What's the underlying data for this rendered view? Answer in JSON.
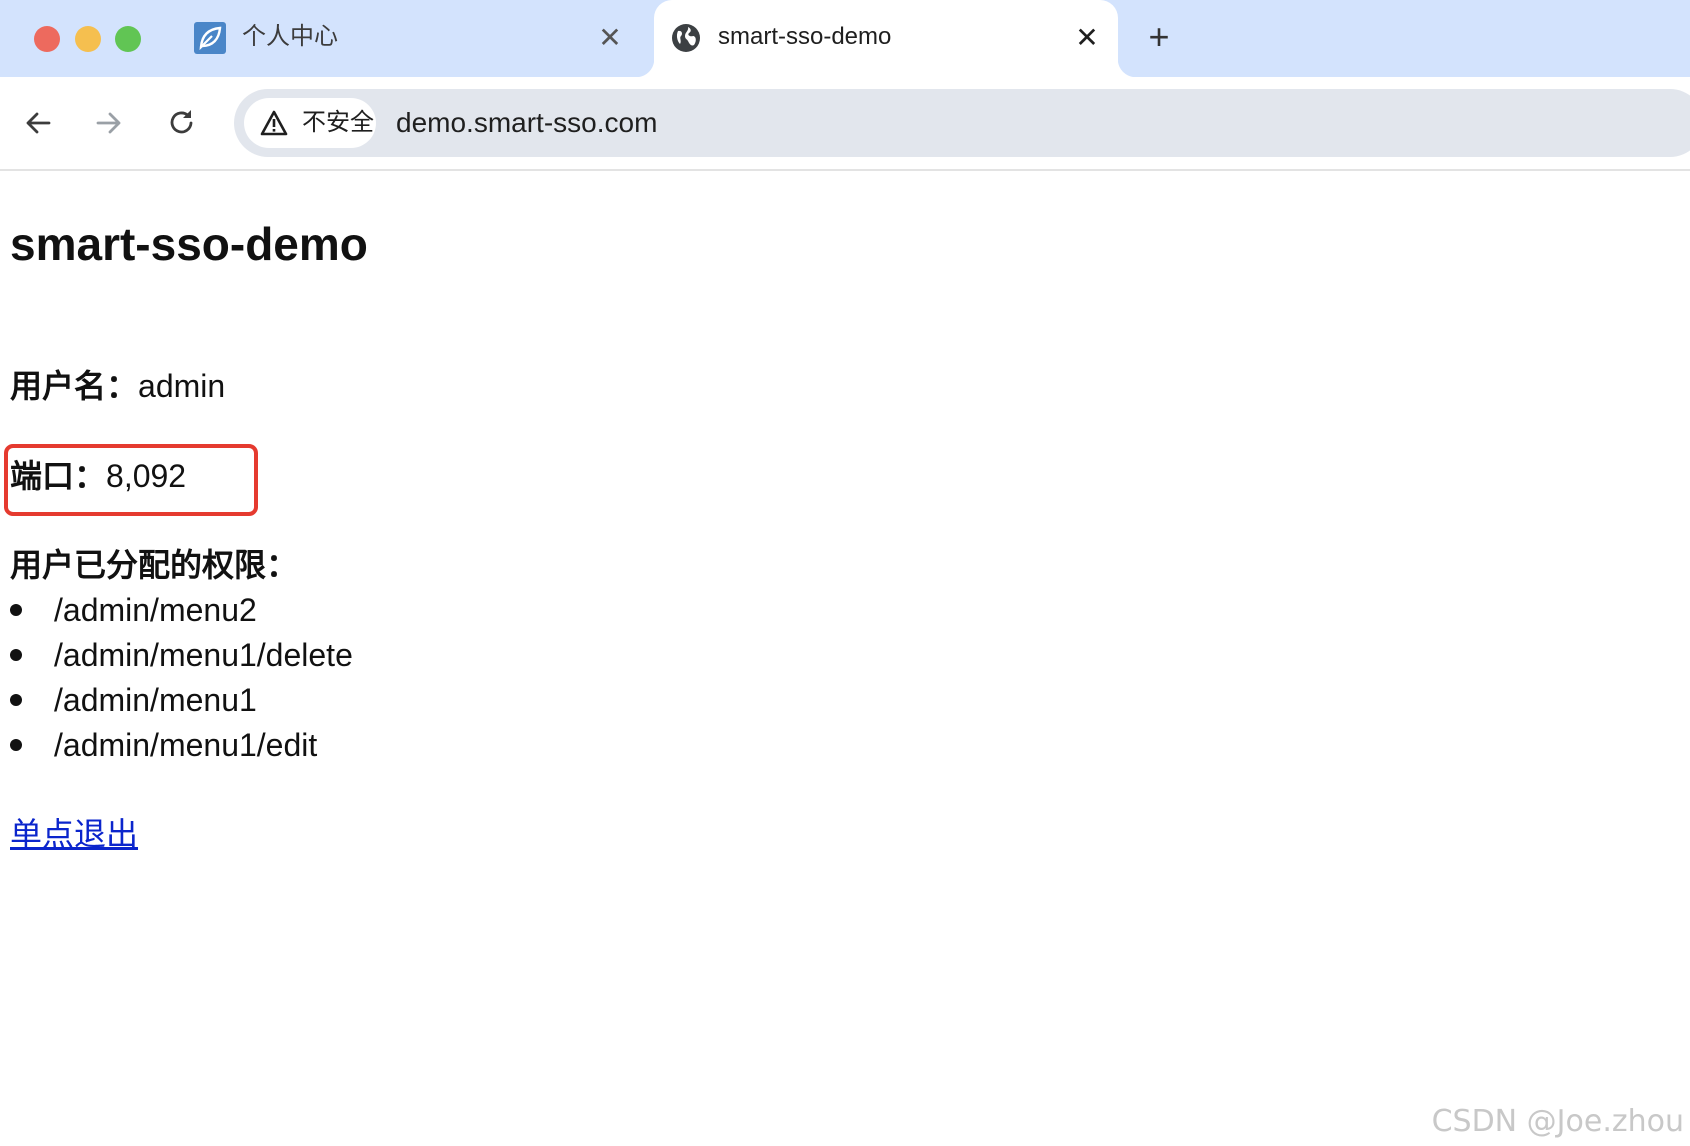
{
  "tabs": [
    {
      "title": "个人中心",
      "favicon": "leaf-icon",
      "active": false
    },
    {
      "title": "smart-sso-demo",
      "favicon": "globe-icon",
      "active": true
    }
  ],
  "toolbar": {
    "security_label": "不安全",
    "url": "demo.smart-sso.com"
  },
  "page": {
    "title": "smart-sso-demo",
    "username_label": "用户名：",
    "username_value": "admin",
    "port_label": "端口：",
    "port_value": "8,092",
    "permissions_heading": "用户已分配的权限：",
    "permissions": [
      "/admin/menu2",
      "/admin/menu1/delete",
      "/admin/menu1",
      "/admin/menu1/edit"
    ],
    "logout_link": "单点退出"
  },
  "watermark": "CSDN @Joe.zhou",
  "colors": {
    "tabstrip": "#d3e3fd",
    "highlight": "#e53a2f",
    "link": "#0b25cc"
  }
}
